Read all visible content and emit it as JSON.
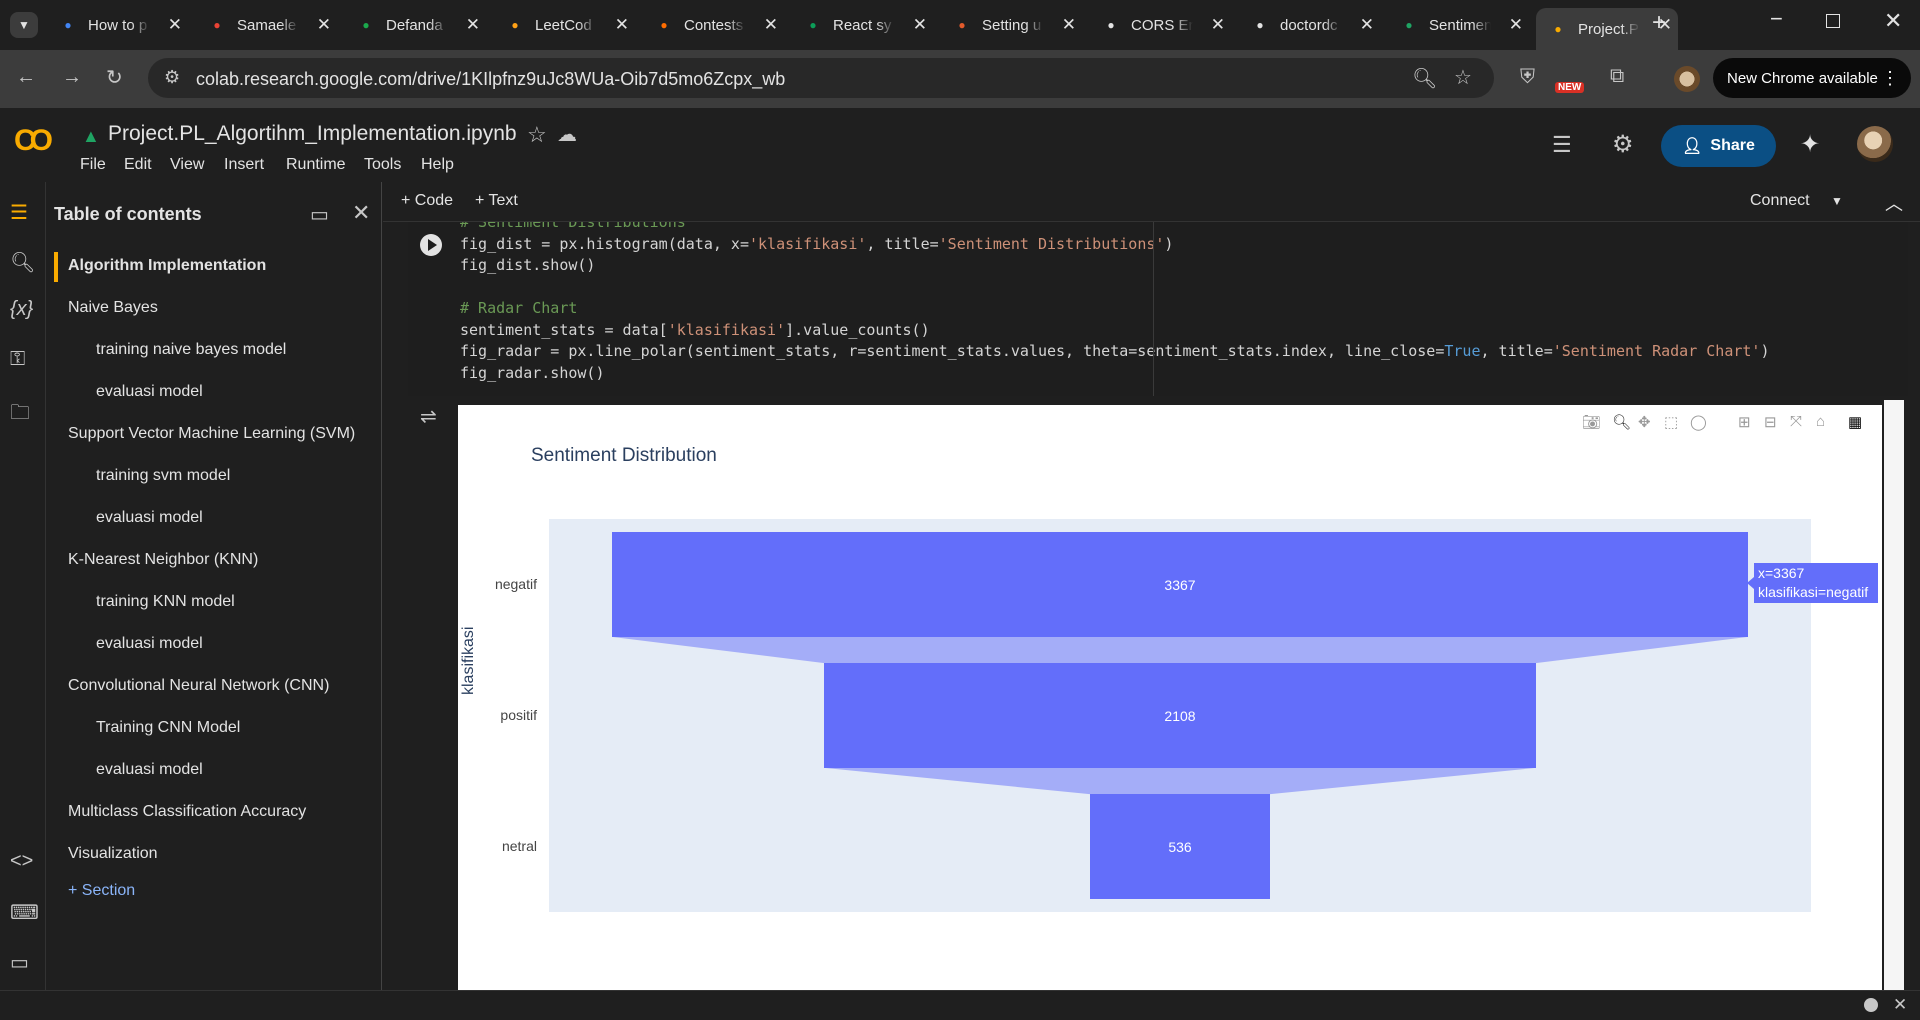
{
  "browser": {
    "tabs": [
      {
        "title": "How to p",
        "icon": "chrome-icon",
        "color": "#4285f4"
      },
      {
        "title": "Samaele",
        "icon": "gmail-icon",
        "color": "#ea4335"
      },
      {
        "title": "Defanda",
        "icon": "hackerrank-icon",
        "color": "#1ba94c"
      },
      {
        "title": "LeetCod",
        "icon": "leetcode-icon",
        "color": "#ffa116"
      },
      {
        "title": "Contests",
        "icon": "chart-icon",
        "color": "#ff6d00"
      },
      {
        "title": "React sy",
        "icon": "react-icon",
        "color": "#0c9d58"
      },
      {
        "title": "Setting u",
        "icon": "sparkle-icon",
        "color": "#e25a2b"
      },
      {
        "title": "CORS Er",
        "icon": "chatgpt-icon",
        "color": "#e3e3e3"
      },
      {
        "title": "doctordc",
        "icon": "github-icon",
        "color": "#e3e3e3"
      },
      {
        "title": "Sentimen",
        "icon": "drive-icon",
        "color": "#1fa463"
      },
      {
        "title": "Project.P",
        "icon": "colab-icon",
        "color": "#f9ab00"
      }
    ],
    "url": "colab.research.google.com/drive/1KIlpfnz9uJc8WUa-Oib7d5mo6Zcpx_wb",
    "new_badge": "NEW",
    "new_chrome": "New Chrome available"
  },
  "colab": {
    "title": "Project.PL_Algortihm_Implementation.ipynb",
    "menu": [
      "File",
      "Edit",
      "View",
      "Insert",
      "Runtime",
      "Tools",
      "Help"
    ],
    "share": "Share",
    "add_code": "+ Code",
    "add_text": "+ Text",
    "connect": "Connect"
  },
  "toc": {
    "header": "Table of contents",
    "items": [
      {
        "label": "Algorithm Implementation",
        "level": 1,
        "selected": true
      },
      {
        "label": "Naive Bayes",
        "level": 1
      },
      {
        "label": "training naive bayes model",
        "level": 2
      },
      {
        "label": "evaluasi model",
        "level": 2
      },
      {
        "label": "Support Vector Machine Learning (SVM)",
        "level": 1
      },
      {
        "label": "training svm model",
        "level": 2
      },
      {
        "label": "evaluasi model",
        "level": 2
      },
      {
        "label": "K-Nearest Neighbor (KNN)",
        "level": 1
      },
      {
        "label": "training KNN model",
        "level": 2
      },
      {
        "label": "evaluasi model",
        "level": 2
      },
      {
        "label": "Convolutional Neural Network (CNN)",
        "level": 1
      },
      {
        "label": "Training CNN Model",
        "level": 2
      },
      {
        "label": "evaluasi model",
        "level": 2
      },
      {
        "label": "Multiclass Classification Accuracy",
        "level": 1
      },
      {
        "label": "Visualization",
        "level": 1
      }
    ],
    "add_section": "Section"
  },
  "code": {
    "lines": [
      "# Sentiment Distributions",
      "fig_dist = px.histogram(data, x='klasifikasi', title='Sentiment Distributions')",
      "fig_dist.show()",
      "",
      "# Radar Chart",
      "sentiment_stats = data['klasifikasi'].value_counts()",
      "fig_radar = px.line_polar(sentiment_stats, r=sentiment_stats.values, theta=sentiment_stats.index, line_close=True, title='Sentiment Radar Chart')",
      "fig_radar.show()"
    ]
  },
  "chart_data": {
    "type": "funnel",
    "title": "Sentiment Distribution",
    "ylabel": "klasifikasi",
    "categories": [
      "negatif",
      "positif",
      "netral"
    ],
    "values": [
      3367,
      2108,
      536
    ],
    "bar_color": "#636efa",
    "hover": {
      "line1": "x=3367",
      "line2": "klasifikasi=negatif"
    }
  }
}
